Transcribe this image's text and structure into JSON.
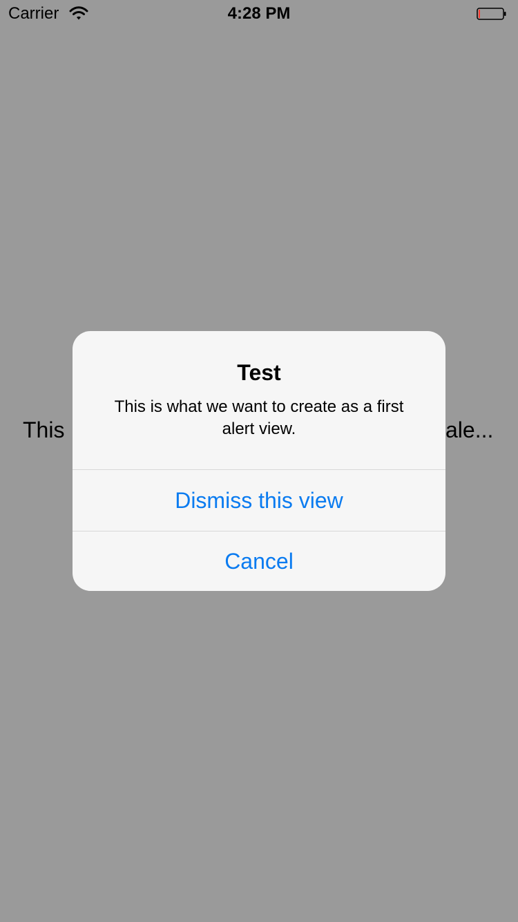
{
  "status_bar": {
    "carrier": "Carrier",
    "time": "4:28 PM"
  },
  "background": {
    "text_left": "This",
    "text_right": "ale..."
  },
  "alert": {
    "title": "Test",
    "message": "This is what we want to create as a first alert view.",
    "actions": [
      {
        "label": "Dismiss this view"
      },
      {
        "label": "Cancel"
      }
    ]
  },
  "colors": {
    "overlay": "#9a9a9a",
    "alert_background": "#f6f6f6",
    "action_text": "#0a7bf0",
    "battery_indicator": "#ff3b30"
  },
  "icons": [
    "wifi-icon",
    "battery-icon"
  ]
}
